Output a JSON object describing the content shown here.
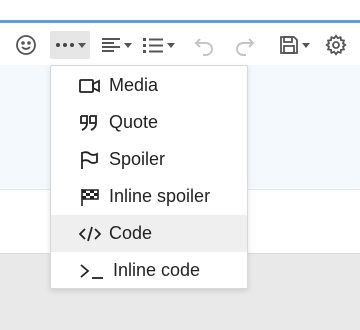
{
  "toolbar": {
    "buttons": [
      {
        "icon": "smiley-icon"
      },
      {
        "icon": "more-options-icon",
        "active": true
      },
      {
        "icon": "align-icon"
      },
      {
        "icon": "list-icon"
      },
      {
        "icon": "undo-icon",
        "disabled": true
      },
      {
        "icon": "redo-icon",
        "disabled": true
      },
      {
        "icon": "save-draft-icon"
      },
      {
        "icon": "gear-icon"
      }
    ]
  },
  "insert_menu": {
    "items": [
      {
        "label": "Media",
        "icon": "video-camera-icon"
      },
      {
        "label": "Quote",
        "icon": "quote-icon"
      },
      {
        "label": "Spoiler",
        "icon": "flag-icon"
      },
      {
        "label": "Inline spoiler",
        "icon": "checkered-flag-icon"
      },
      {
        "label": "Code",
        "icon": "code-icon",
        "highlighted": true
      },
      {
        "label": "Inline code",
        "icon": "terminal-icon"
      }
    ]
  },
  "colors": {
    "accent": "#5aa0dc",
    "menu_hover": "#efefef",
    "icon": "#555555",
    "icon_disabled": "#c6c6c6"
  }
}
